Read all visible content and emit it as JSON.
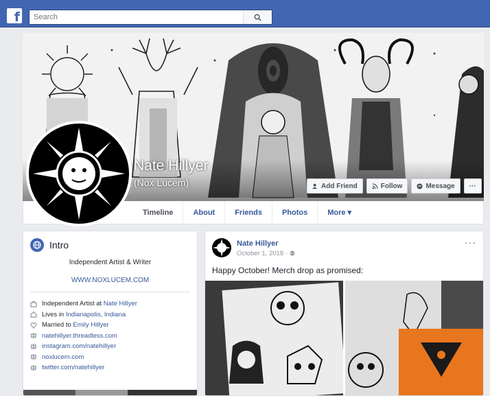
{
  "topbar": {
    "logo": "f",
    "search_placeholder": "Search"
  },
  "profile": {
    "name": "Nate Hillyer",
    "alternate_name": "(Nox Lucem)"
  },
  "cover_actions": {
    "add_friend": "Add Friend",
    "follow": "Follow",
    "message": "Message",
    "more": "···"
  },
  "tabs": [
    {
      "label": "Timeline"
    },
    {
      "label": "About"
    },
    {
      "label": "Friends"
    },
    {
      "label": "Photos"
    },
    {
      "label": "More ▾"
    }
  ],
  "intro": {
    "title": "Intro",
    "bio": "Independent Artist & Writer",
    "website": "WWW.NOXLUCEM.COM",
    "items": [
      {
        "icon": "briefcase-icon",
        "prefix": "Independent Artist at ",
        "link": "Nate Hillyer"
      },
      {
        "icon": "home-icon",
        "prefix": "Lives in ",
        "link": "Indianapolis, Indiana"
      },
      {
        "icon": "heart-icon",
        "prefix": "Married to ",
        "link": "Emily Hillyer"
      },
      {
        "icon": "globe-icon",
        "prefix": "",
        "link": "natehillyer.threadless.com"
      },
      {
        "icon": "globe-icon",
        "prefix": "",
        "link": "instagram.com/natehillyer"
      },
      {
        "icon": "globe-icon",
        "prefix": "",
        "link": "noxlucem.com"
      },
      {
        "icon": "globe-icon",
        "prefix": "",
        "link": "twitter.com/natehillyer"
      }
    ]
  },
  "post": {
    "author": "Nate Hillyer",
    "date": "October 1, 2018 · ",
    "more": "···",
    "text": "Happy October! Merch drop as promised:"
  },
  "colors": {
    "brand": "#4267b2",
    "link": "#365899",
    "background": "#e9ebee",
    "accent_orange": "#e8761e"
  }
}
